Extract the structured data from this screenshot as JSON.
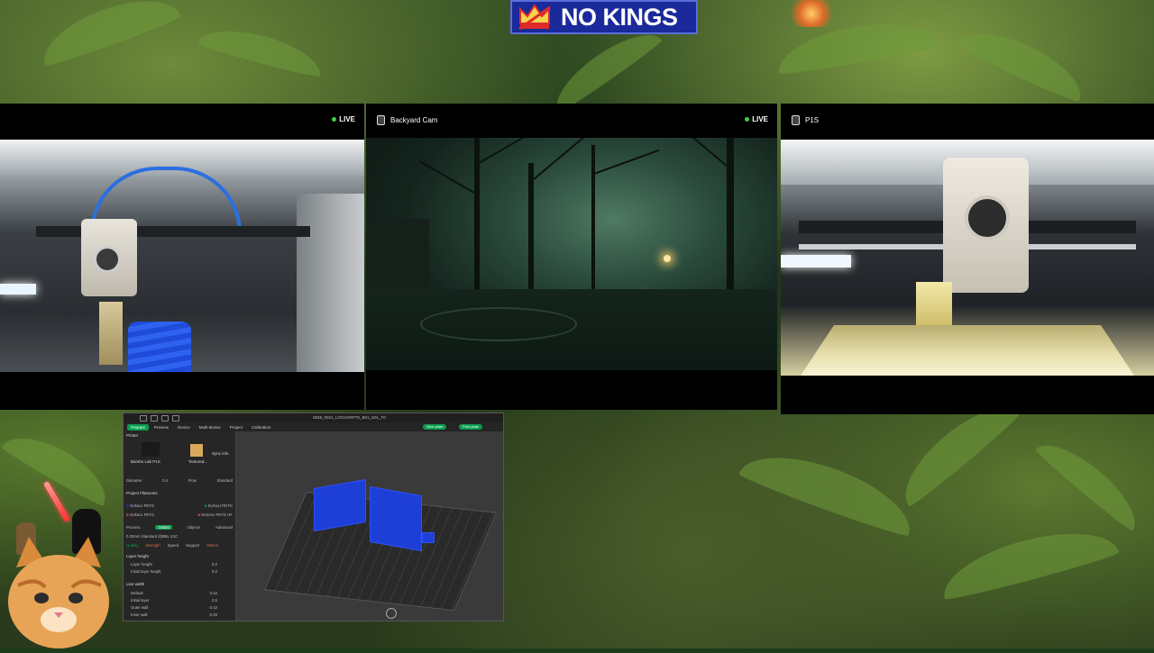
{
  "logo": {
    "text": "NO KINGS",
    "bg_color": "#1a2a9a",
    "icon": "crown-icon"
  },
  "cameras": [
    {
      "name": "",
      "live": "LIVE",
      "scene": "printer-interior-blue-print"
    },
    {
      "name": "Backyard Cam",
      "live": "LIVE",
      "scene": "backyard-night"
    },
    {
      "name": "P1S",
      "live": "",
      "scene": "printer-interior-p1s"
    }
  ],
  "studio": {
    "title": "0828_0021_LOCKDRPT0_B01_S01_T0",
    "tabs": [
      "Prepare",
      "Preview",
      "Device",
      "Multi-device",
      "Project",
      "Calibration"
    ],
    "active_tab": "Prepare",
    "buttons": {
      "slice": "Slice plate",
      "print": "Print plate"
    },
    "printer_section": "Printer",
    "printer_name": "Bambu Lab P1S",
    "plate_type": "Textured...",
    "sync": "Sync info",
    "nozzle": {
      "label": "Diameter",
      "value": "0.4",
      "flow_label": "Flow",
      "flow_value": "Standard"
    },
    "filament_section": "Project Filaments",
    "filaments": [
      {
        "slot": "1",
        "name": "SUNLU PETG",
        "color": "#1e3ed8"
      },
      {
        "slot": "2",
        "name": "SUNLU PETG",
        "color": "#e84a3a"
      },
      {
        "slot": "3",
        "name": "SUNLU PETG",
        "color": "#1e3ed8"
      },
      {
        "slot": "4",
        "name": "Generic PETG HF",
        "color": "#0b9d4f"
      }
    ],
    "process_label": "Process",
    "process_toggle": "Global",
    "process_obj": "Objects",
    "advanced": "Advanced",
    "profile": "0.20mm Standard @BBL X1C",
    "quality_tabs": [
      "Quality",
      "Strength",
      "Speed",
      "Support",
      "Others"
    ],
    "layer_height_group": "Layer height",
    "layer_rows": [
      {
        "label": "Layer height",
        "value": "0.2"
      },
      {
        "label": "Initial layer height",
        "value": "0.2"
      }
    ],
    "line_width_group": "Line width",
    "line_rows": [
      {
        "label": "Default",
        "value": "0.42"
      },
      {
        "label": "Initial layer",
        "value": "0.5"
      },
      {
        "label": "Outer wall",
        "value": "0.42"
      },
      {
        "label": "Inner wall",
        "value": "0.45"
      }
    ],
    "accent_color": "#0b9d4f",
    "model_color": "#1e3ed8"
  }
}
